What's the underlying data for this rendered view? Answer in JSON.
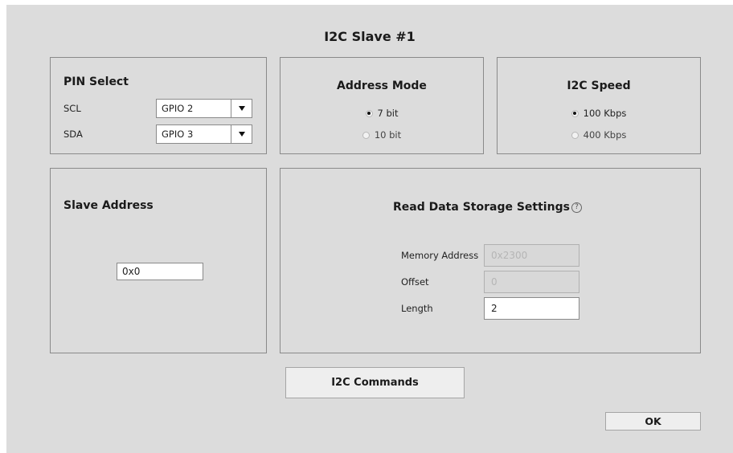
{
  "dialog": {
    "title": "I2C Slave #1"
  },
  "pin_select": {
    "title": "PIN Select",
    "scl_label": "SCL",
    "scl_value": "GPIO 2",
    "sda_label": "SDA",
    "sda_value": "GPIO 3"
  },
  "address_mode": {
    "title": "Address Mode",
    "options": [
      "7 bit",
      "10 bit"
    ],
    "selected": "7 bit"
  },
  "i2c_speed": {
    "title": "I2C Speed",
    "options": [
      "100 Kbps",
      "400 Kbps"
    ],
    "selected": "100 Kbps"
  },
  "slave_address": {
    "title": "Slave Address",
    "value": "0x0"
  },
  "read_storage": {
    "title": "Read Data Storage Settings",
    "help_icon": "question-circle-icon",
    "memory_address_label": "Memory Address",
    "memory_address_value": "0x2300",
    "offset_label": "Offset",
    "offset_value": "0",
    "length_label": "Length",
    "length_value": "2"
  },
  "buttons": {
    "commands": "I2C Commands",
    "ok": "OK"
  }
}
